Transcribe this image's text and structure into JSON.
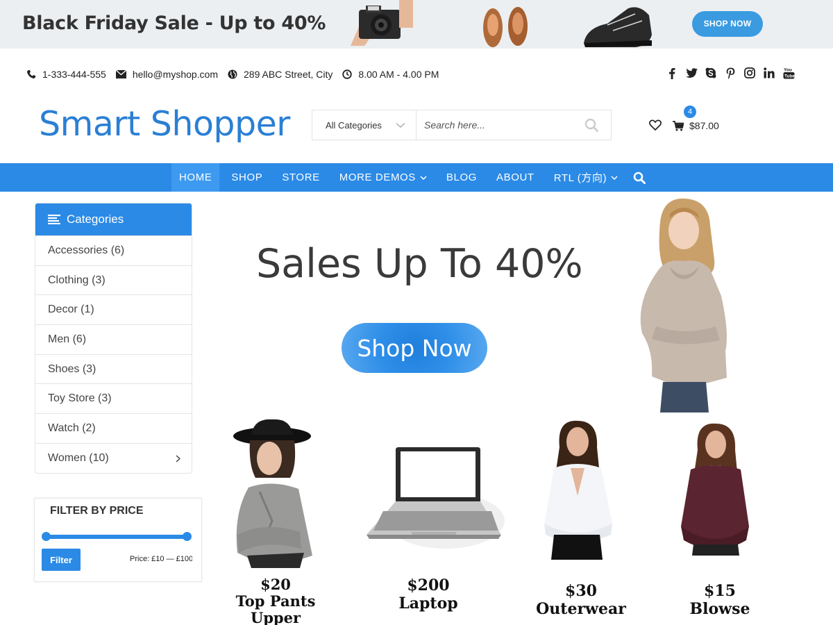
{
  "promo": {
    "title": "Black Friday Sale - Up to 40%",
    "button_label": "SHOP NOW"
  },
  "contact": {
    "phone": "1-333-444-555",
    "email": "hello@myshop.com",
    "address": "289 ABC Street, City",
    "hours": "8.00 AM - 4.00 PM"
  },
  "social_icons": [
    "facebook-icon",
    "twitter-icon",
    "skype-icon",
    "pinterest-icon",
    "instagram-icon",
    "linkedin-icon",
    "youtube-icon"
  ],
  "header": {
    "logo": "Smart Shopper",
    "search_category": "All Categories",
    "search_placeholder": "Search here...",
    "cart_count": "4",
    "cart_total": "$87.00"
  },
  "nav": {
    "items": [
      "HOME",
      "SHOP",
      "STORE",
      "MORE DEMOS",
      "BLOG",
      "ABOUT",
      "RTL (方向)"
    ],
    "active": "HOME"
  },
  "sidebar": {
    "title": "Categories",
    "categories": [
      "Accessories (6)",
      "Clothing (3)",
      "Decor (1)",
      "Men (6)",
      "Shoes (3)",
      "Toy Store (3)",
      "Watch (2)",
      "Women (10)"
    ]
  },
  "filter": {
    "title": "FILTER BY PRICE",
    "button_label": "Filter",
    "price_text": "Price: £10 — £100"
  },
  "hero": {
    "title": "Sales Up To 40%",
    "button_label": "Shop Now"
  },
  "products": [
    {
      "price": "$20",
      "name": "Top Pants Upper"
    },
    {
      "price": "$200",
      "name": "Laptop"
    },
    {
      "price": "$30",
      "name": "Outerwear"
    },
    {
      "price": "$15",
      "name": "Blowse"
    }
  ],
  "colors": {
    "accent": "#2b8ae6",
    "logo": "#2a7fd4",
    "promo_button": "#3a9be0"
  }
}
